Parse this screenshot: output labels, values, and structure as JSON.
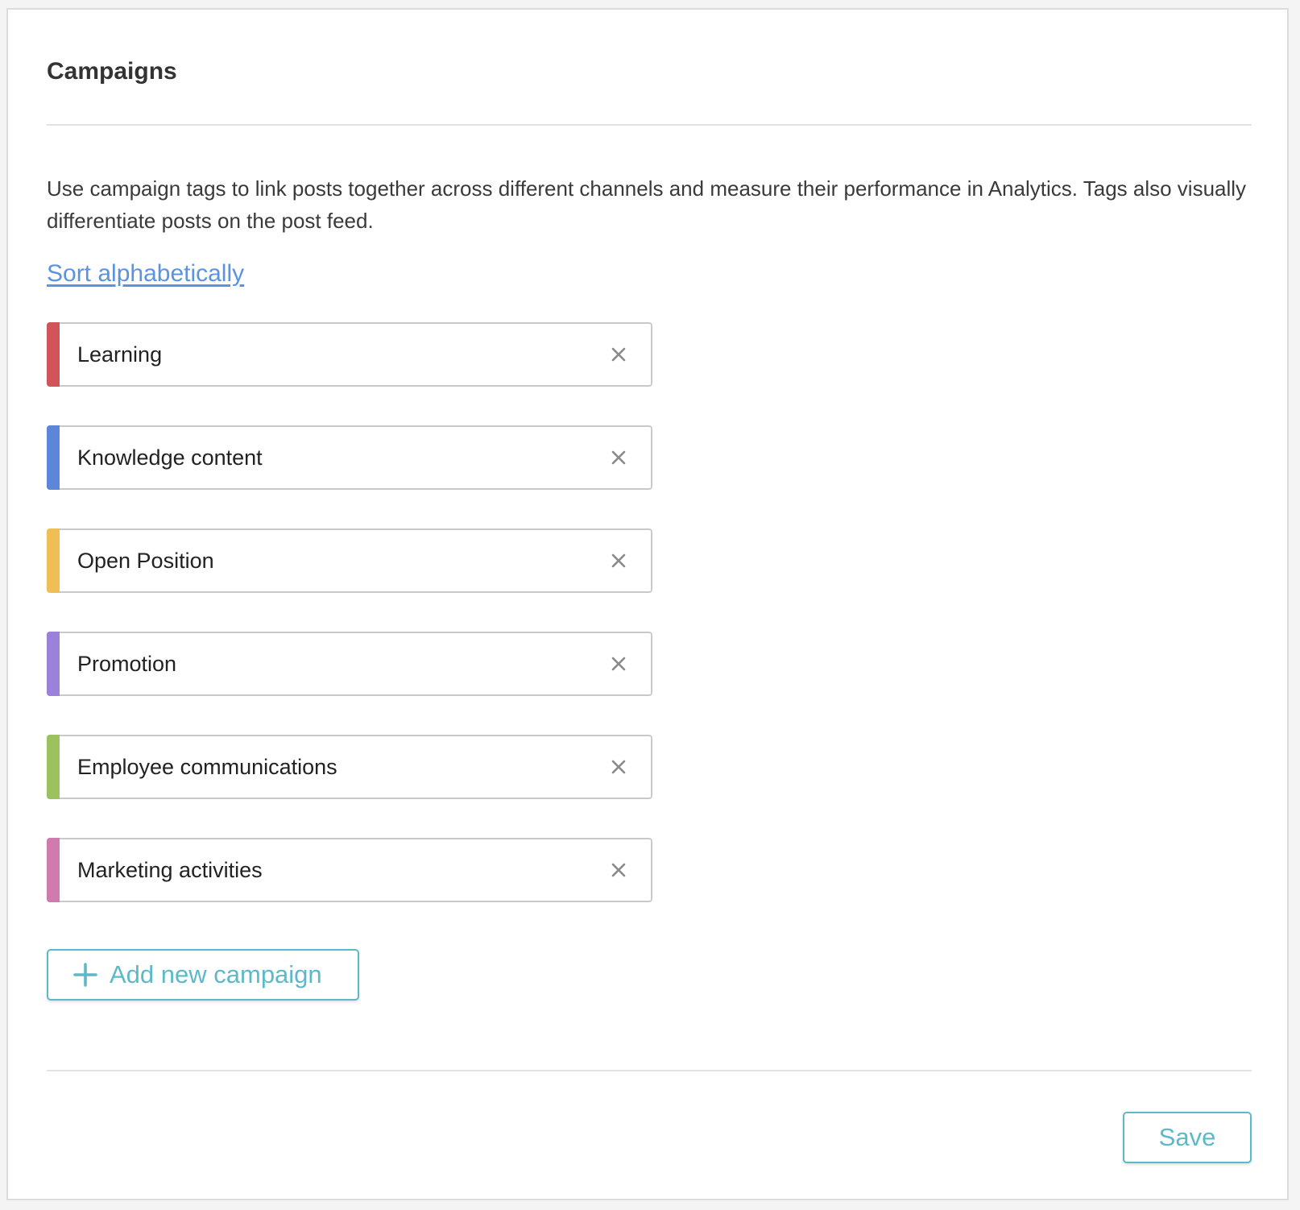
{
  "panel": {
    "title": "Campaigns",
    "description": "Use campaign tags to link posts together across different channels and measure their performance in Analytics. Tags also visually differentiate posts on the post feed.",
    "sort_link_label": "Sort alphabetically"
  },
  "campaigns": [
    {
      "name": "Learning",
      "color": "#d0545a"
    },
    {
      "name": "Knowledge content",
      "color": "#5b86d9"
    },
    {
      "name": "Open Position",
      "color": "#efbf55"
    },
    {
      "name": "Promotion",
      "color": "#9a81d9"
    },
    {
      "name": "Employee communications",
      "color": "#9cc25f"
    },
    {
      "name": "Marketing activities",
      "color": "#d07ab0"
    }
  ],
  "actions": {
    "add_campaign_label": "Add new campaign",
    "save_label": "Save"
  },
  "icons": {
    "remove": "close-icon",
    "add": "plus-icon"
  },
  "colors": {
    "accent": "#5cbac8",
    "link": "#5b93e0"
  }
}
